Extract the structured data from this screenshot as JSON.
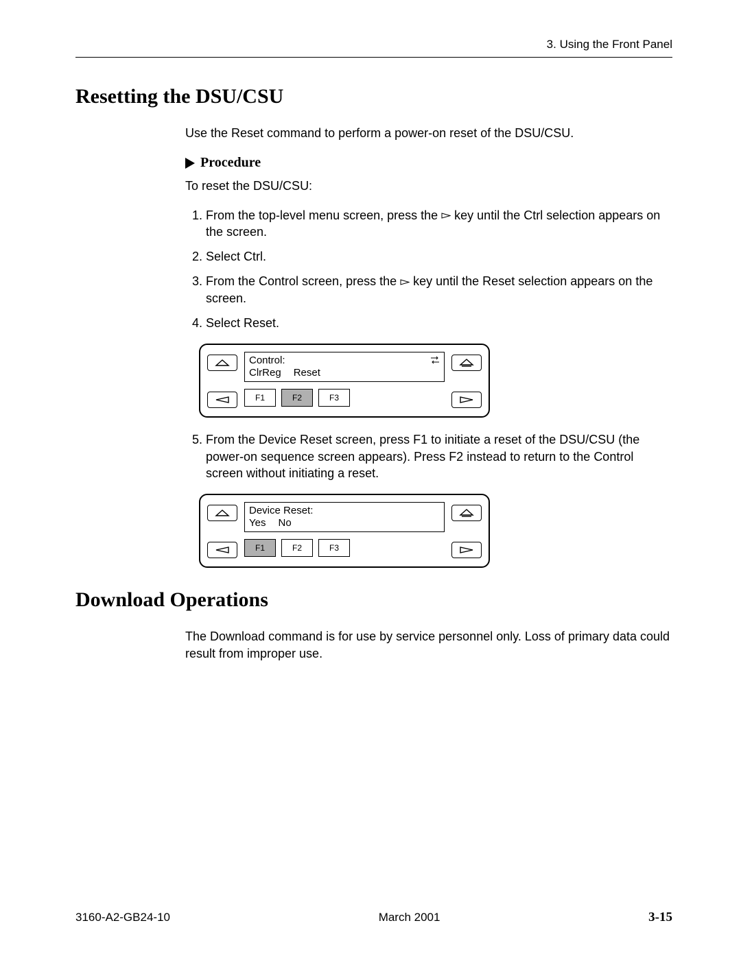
{
  "header": {
    "chapter": "3. Using the Front Panel"
  },
  "section1": {
    "heading": "Resetting the DSU/CSU",
    "intro": "Use the Reset command to perform a power-on reset of the DSU/CSU.",
    "procedure_label": "Procedure",
    "lead": "To reset the DSU/CSU:",
    "steps": {
      "s1a": "From the top-level menu screen, press the ",
      "s1b": " key until the Ctrl selection appears on the screen.",
      "s2": "Select Ctrl.",
      "s3a": "From the Control screen, press the ",
      "s3b": " key until the Reset selection appears on the screen.",
      "s4": "Select Reset.",
      "s5": "From the Device Reset screen, press F1 to initiate a reset of the DSU/CSU (the power-on sequence screen appears). Press F2 instead to return to the Control screen without initiating a reset."
    }
  },
  "panel1": {
    "line1": "Control:",
    "opt1": "ClrReg",
    "opt2": "Reset",
    "f1": "F1",
    "f2": "F2",
    "f3": "F3"
  },
  "panel2": {
    "line1": "Device Reset:",
    "opt1": "Yes",
    "opt2": "No",
    "f1": "F1",
    "f2": "F2",
    "f3": "F3"
  },
  "section2": {
    "heading": "Download Operations",
    "body": "The Download command is for use by service personnel only. Loss of primary data could result from improper use."
  },
  "footer": {
    "doc": "3160-A2-GB24-10",
    "date": "March 2001",
    "page": "3-15"
  }
}
